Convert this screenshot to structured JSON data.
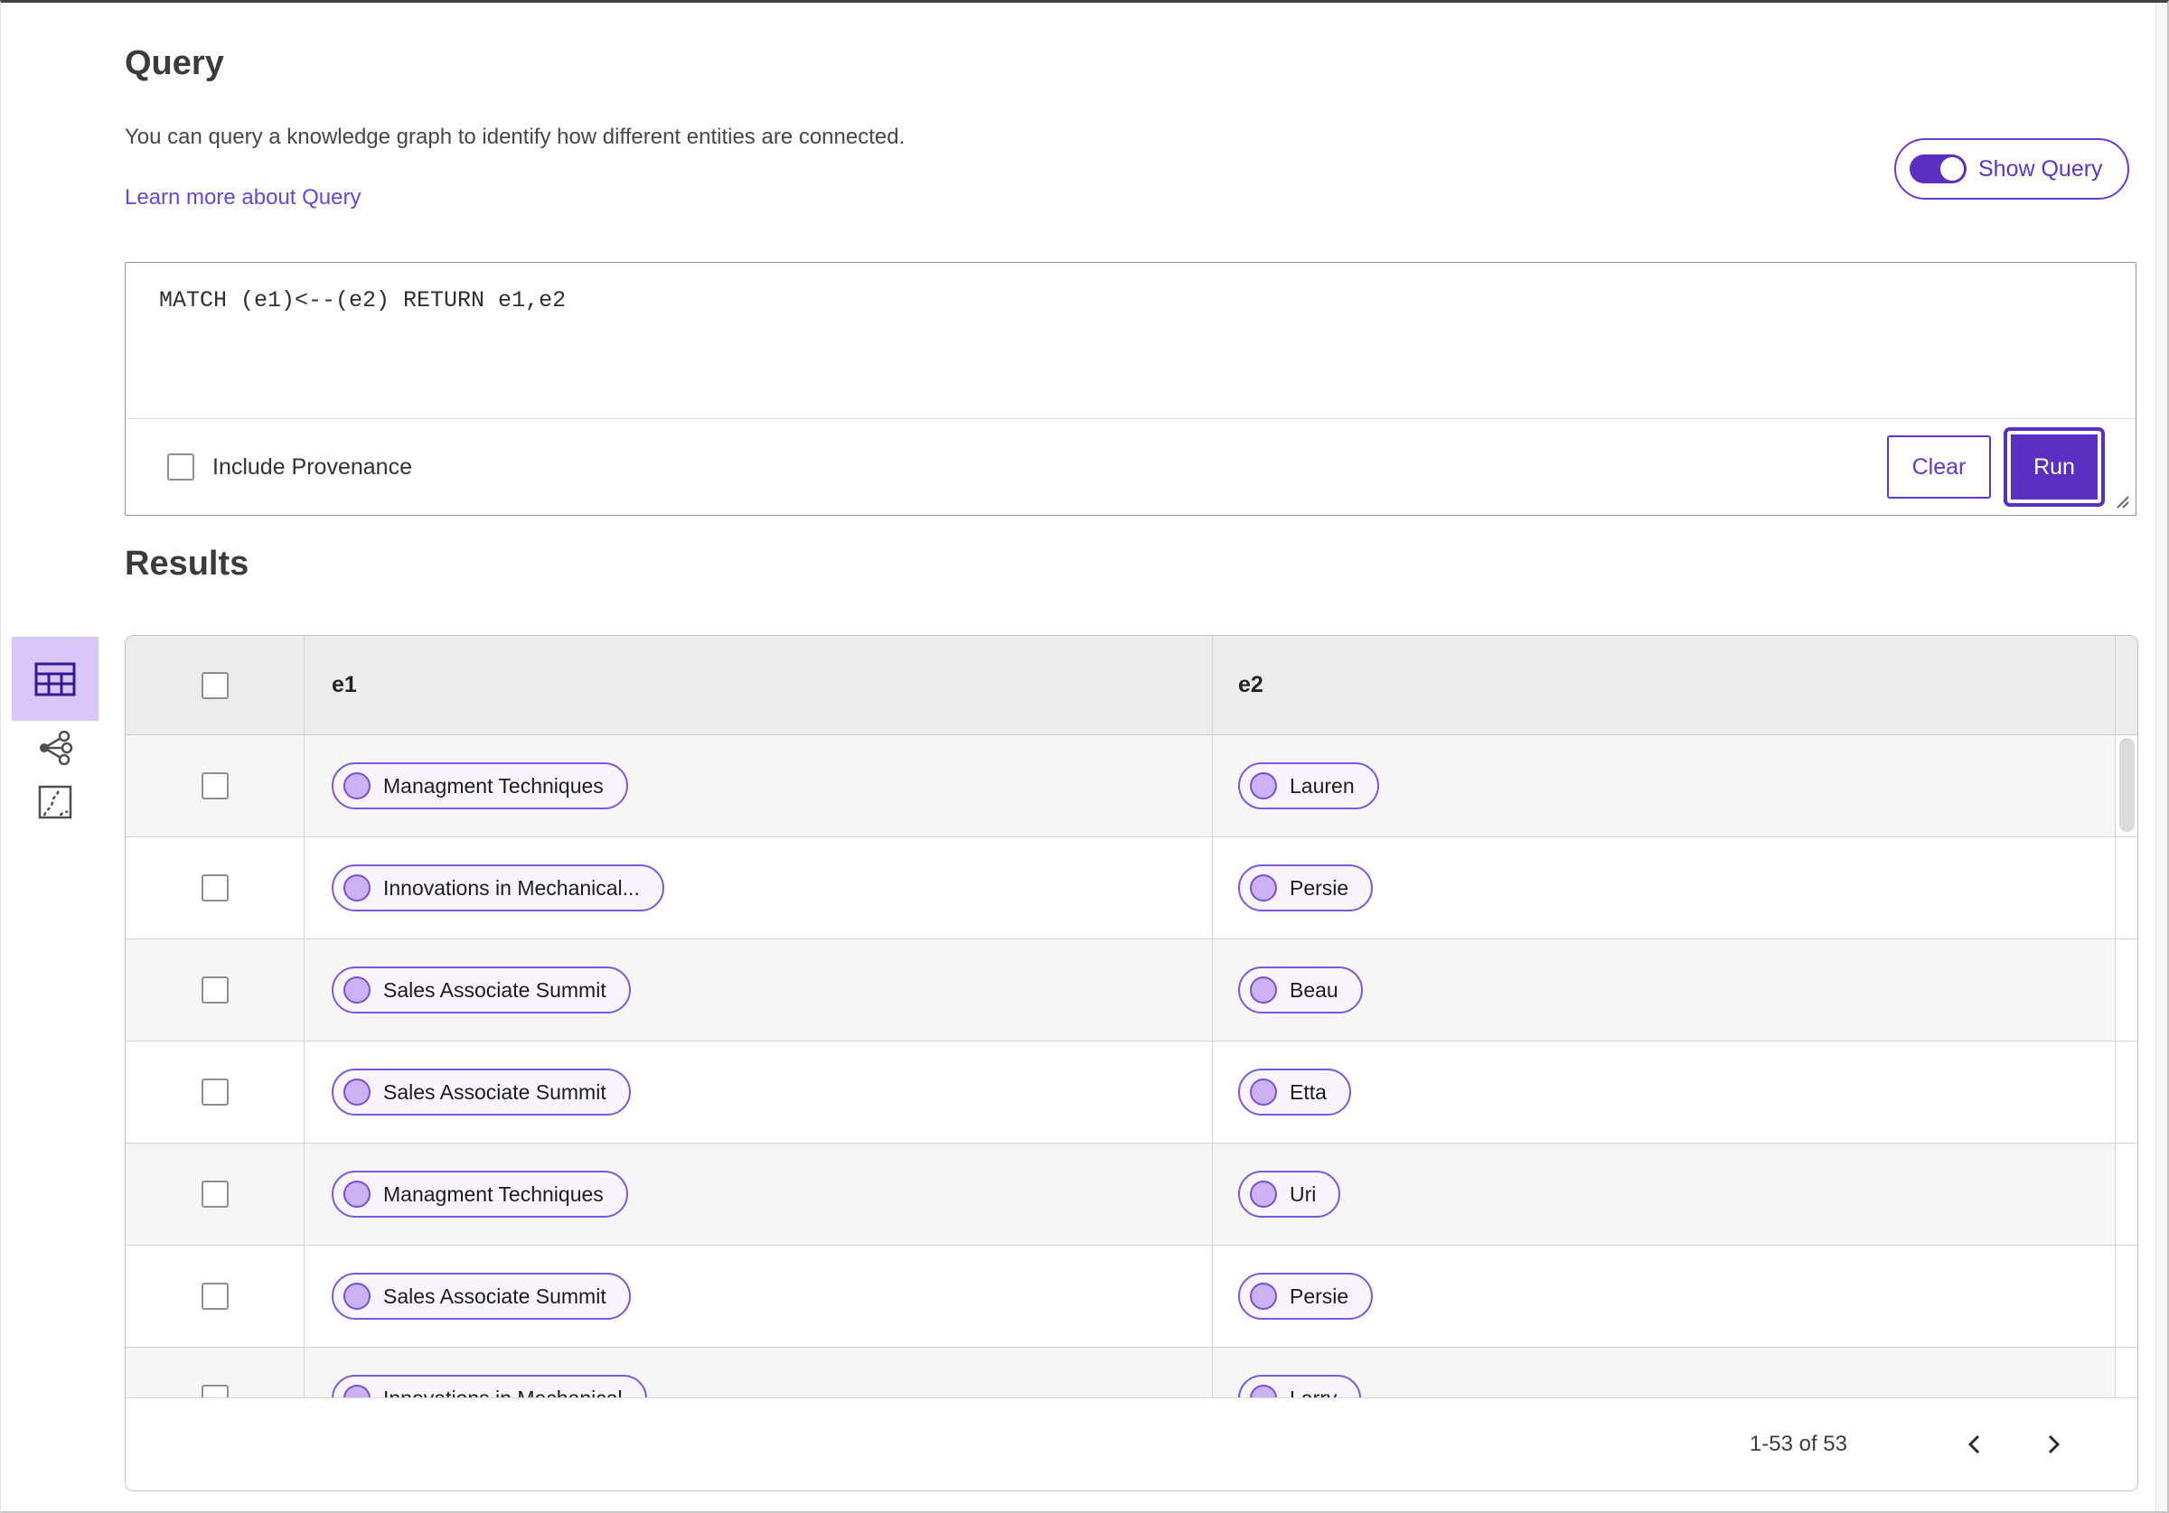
{
  "query_section": {
    "title": "Query",
    "description": "You can query a knowledge graph to identify how different entities are connected.",
    "learn_more_link": "Learn more about Query",
    "show_query_label": "Show Query",
    "show_query_toggle_state": "on",
    "query_text": "MATCH (e1)<--(e2) RETURN e1,e2",
    "include_provenance_label": "Include Provenance",
    "include_provenance_checked": false,
    "clear_button_label": "Clear",
    "run_button_label": "Run"
  },
  "results_section": {
    "title": "Results",
    "view_switcher": [
      {
        "name": "table-view",
        "icon": "table-grid-icon",
        "selected": true
      },
      {
        "name": "graph-view",
        "icon": "graph-network-icon",
        "selected": false
      },
      {
        "name": "map-view",
        "icon": "route-map-icon",
        "selected": false
      }
    ]
  },
  "table": {
    "columns": [
      "e1",
      "e2"
    ],
    "select_all_checked": false,
    "rows": [
      {
        "e1": "Managment Techniques",
        "e2": "Lauren"
      },
      {
        "e1": "Innovations in Mechanical...",
        "e2": "Persie"
      },
      {
        "e1": "Sales Associate Summit",
        "e2": "Beau"
      },
      {
        "e1": "Sales Associate Summit",
        "e2": "Etta"
      },
      {
        "e1": "Managment Techniques",
        "e2": "Uri"
      },
      {
        "e1": "Sales Associate Summit",
        "e2": "Persie"
      },
      {
        "e1": "Innovations in Mechanical",
        "e2": "Larry"
      }
    ]
  },
  "pagination": {
    "range_label": "1-53 of 53",
    "prev_icon": "chevron-left-icon",
    "next_icon": "chevron-right-icon"
  },
  "colors": {
    "accent_purple": "#5b2fc2",
    "button_border_purple": "#6236c9",
    "link_purple": "#6747d9",
    "pill_border": "#7e57e0",
    "pill_background": "#f8f5fe",
    "pill_dot_fill": "#ccb2f2",
    "selected_view_background": "#d9c7f8",
    "table_header_background": "#ececec",
    "row_stripe_background": "#f6f6f6"
  }
}
